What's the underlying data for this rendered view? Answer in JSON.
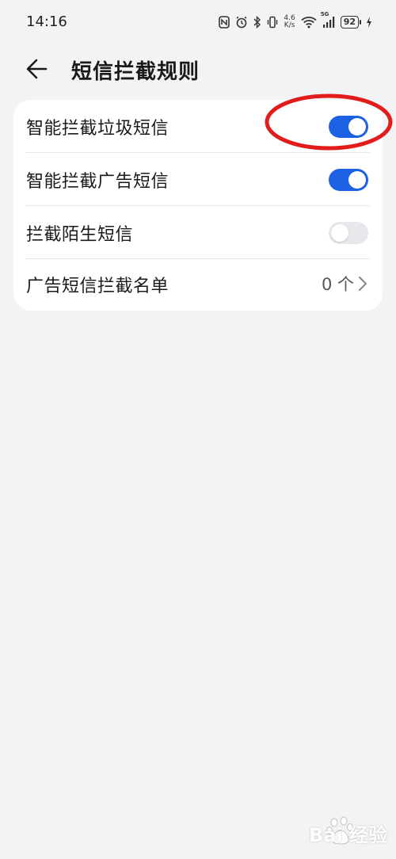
{
  "status_bar": {
    "time": "14:16",
    "net_speed_value": "4.6",
    "net_speed_unit": "K/s",
    "network": "5G",
    "battery": "92",
    "icons": [
      "nfc-icon",
      "alarm-icon",
      "bluetooth-icon",
      "vibrate-icon",
      "wifi-icon",
      "signal-icon",
      "battery-icon",
      "charging-icon"
    ]
  },
  "header": {
    "back_icon": "back-arrow-icon",
    "title": "短信拦截规则"
  },
  "settings": {
    "items": [
      {
        "label": "智能拦截垃圾短信",
        "toggle": true
      },
      {
        "label": "智能拦截广告短信",
        "toggle": true
      },
      {
        "label": "拦截陌生短信",
        "toggle": false
      },
      {
        "label": "广告短信拦截名单",
        "value": "0 个",
        "icon": "chevron-right-icon"
      }
    ]
  },
  "annotation": {
    "color": "#e21b1b",
    "shape": "ellipse"
  },
  "watermark": {
    "text": "Bai 经验"
  },
  "colors": {
    "accent": "#1d62e5",
    "background": "#f1f3f5",
    "card": "#ffffff"
  }
}
